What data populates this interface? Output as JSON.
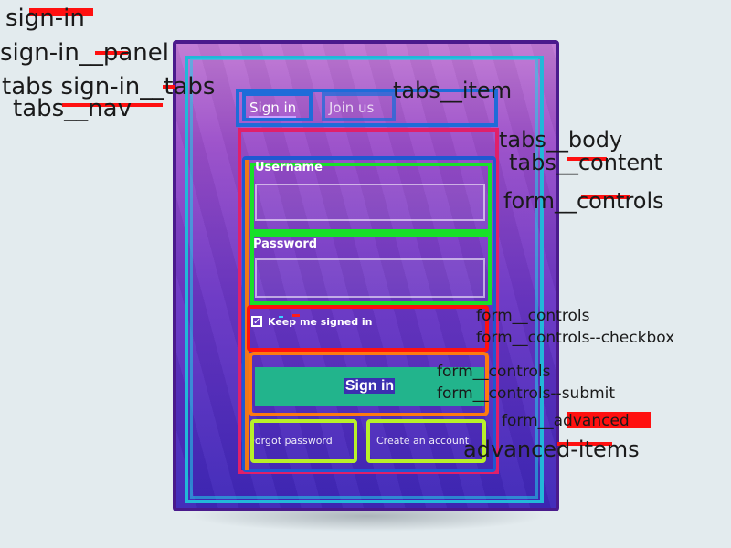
{
  "annotations": {
    "sign_in": "sign-in",
    "sign_in_panel": "sign-in__panel",
    "tabs_sign_in_tabs": "tabs sign-in__tabs",
    "tabs_nav": "tabs__nav",
    "tabs_item": "tabs__item",
    "tabs_body": "tabs__body",
    "tabs_content": "tabs__content",
    "form_controls": "form__controls",
    "form_controls_checkbox_line1": "form__controls",
    "form_controls_checkbox_line2": "form__controls--checkbox",
    "form_controls_submit_line1": "form__controls",
    "form_controls_submit_line2": "form__controls--submit",
    "form_advanced": "form__advanced",
    "advanced_items": "advanced-items"
  },
  "tabs": {
    "sign_in": "Sign in",
    "join_us": "Join us"
  },
  "form": {
    "username_label": "Username",
    "password_label": "Password",
    "checkbox_label": "Keep me signed in",
    "submit_label": "Sign in",
    "forgot_password": "Forgot password",
    "create_account": "Create an account"
  },
  "colors": {
    "page_background": "#e3ebee",
    "panel_gradient_top": "#c17ad4",
    "panel_gradient_bottom": "#3e27b8",
    "submit_button": "#22b48c"
  }
}
